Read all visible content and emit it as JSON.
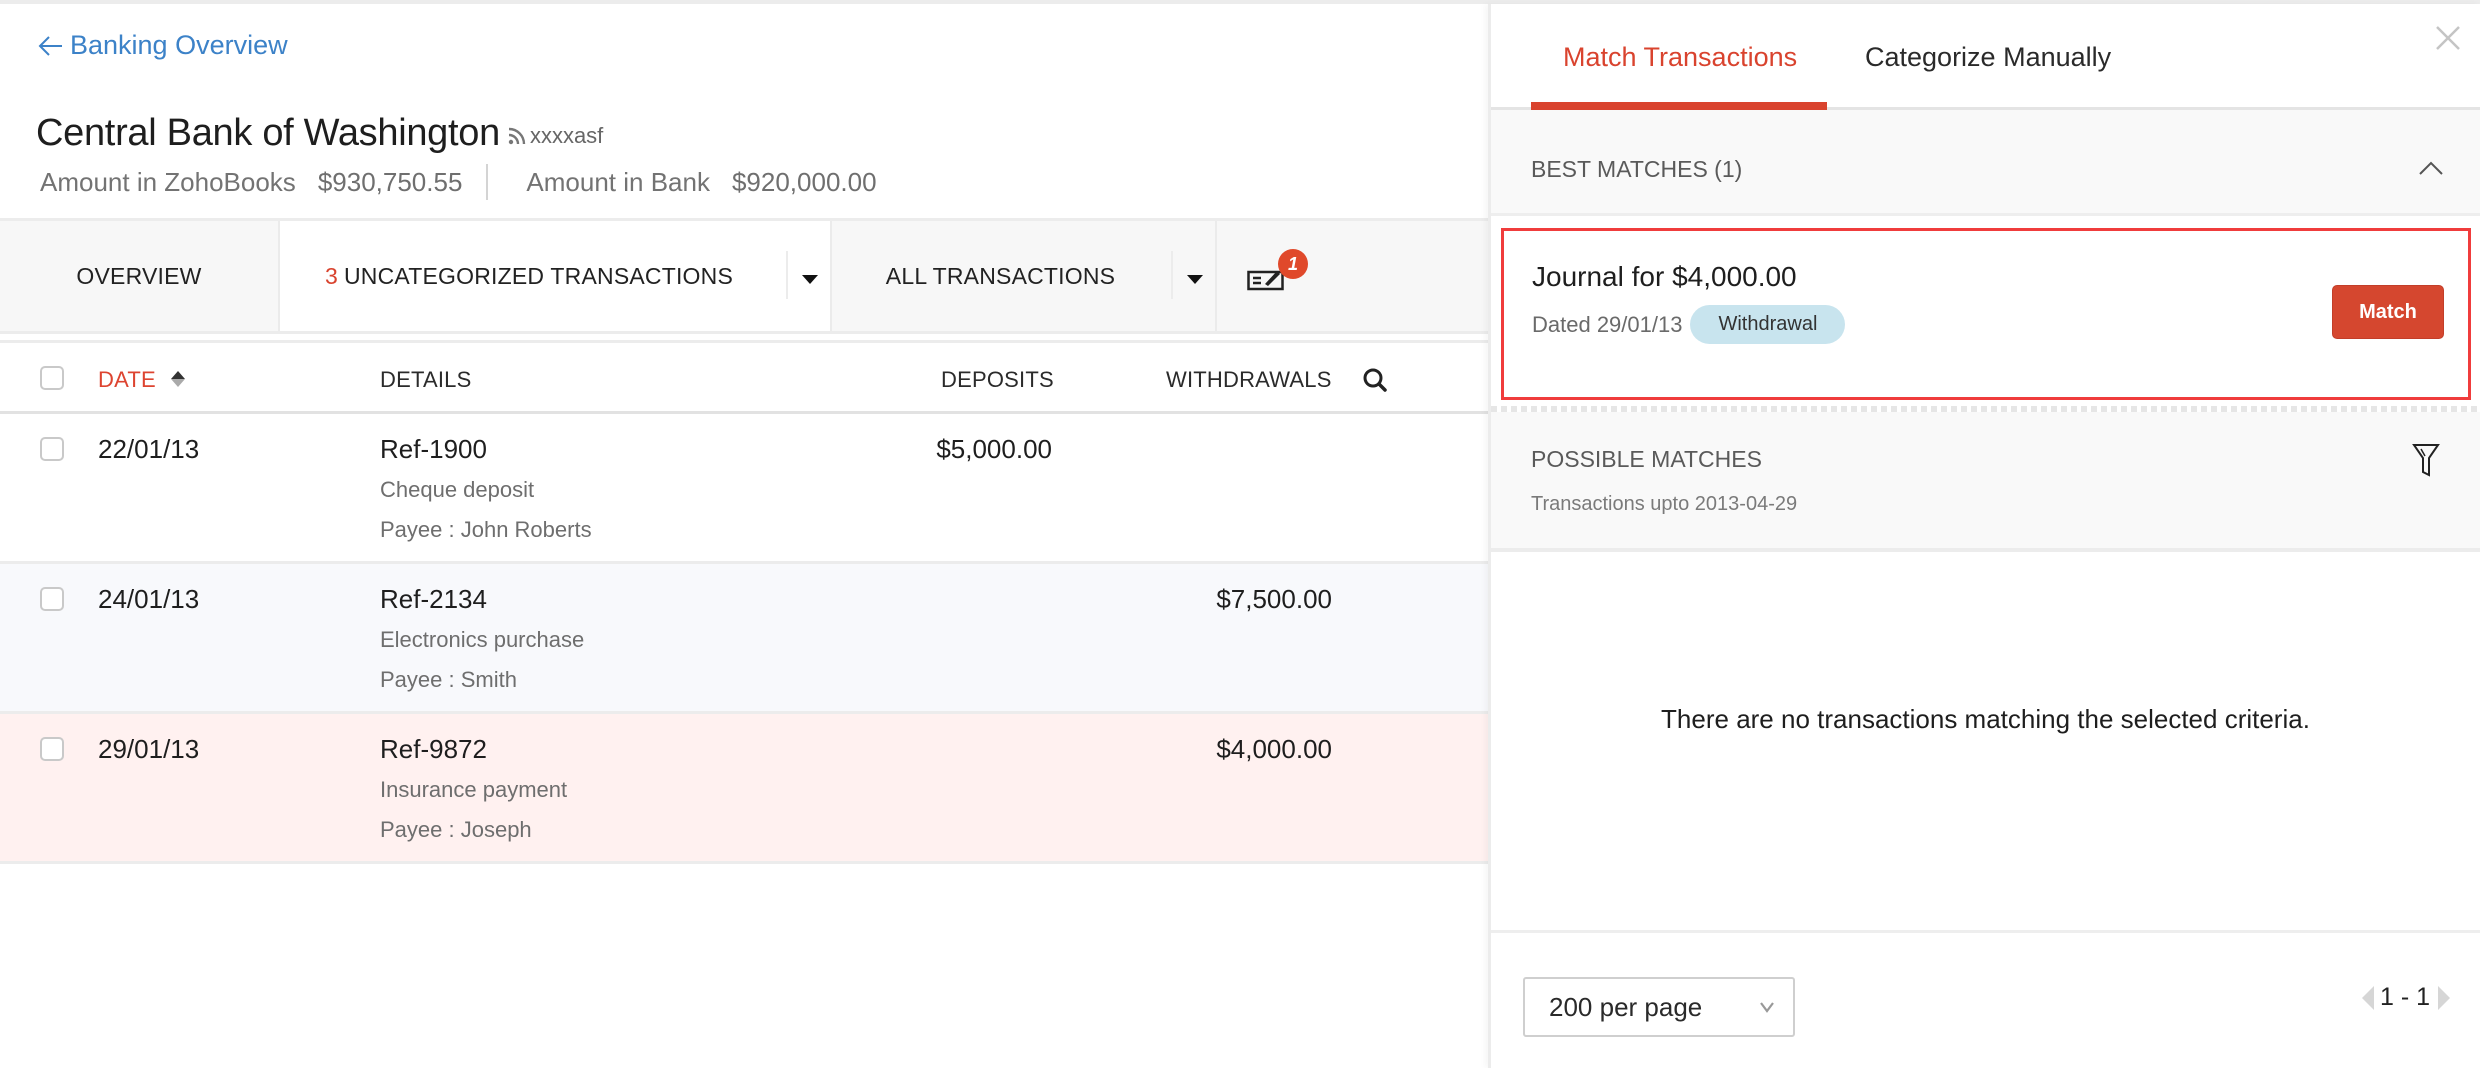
{
  "header": {
    "back_label": "Banking Overview",
    "bank_name": "Central Bank of Washington",
    "feed_account": "xxxxasf",
    "amount_books_label": "Amount in ZohoBooks",
    "amount_books_value": "$930,750.55",
    "amount_bank_label": "Amount in Bank",
    "amount_bank_value": "$920,000.00"
  },
  "tabbar": {
    "overview": "OVERVIEW",
    "uncategorized_count": "3",
    "uncategorized_label": "UNCATEGORIZED TRANSACTIONS",
    "all_transactions": "ALL TRANSACTIONS",
    "cheque_badge": "1"
  },
  "table": {
    "columns": {
      "date": "DATE",
      "details": "DETAILS",
      "deposits": "DEPOSITS",
      "withdrawals": "WITHDRAWALS"
    },
    "rows": [
      {
        "date": "22/01/13",
        "ref": "Ref-1900",
        "description": "Cheque deposit",
        "payee": "Payee : John Roberts",
        "deposit": "$5,000.00",
        "withdrawal": ""
      },
      {
        "date": "24/01/13",
        "ref": "Ref-2134",
        "description": "Electronics purchase",
        "payee": "Payee : Smith",
        "deposit": "",
        "withdrawal": "$7,500.00"
      },
      {
        "date": "29/01/13",
        "ref": "Ref-9872",
        "description": "Insurance payment",
        "payee": "Payee : Joseph",
        "deposit": "",
        "withdrawal": "$4,000.00"
      }
    ]
  },
  "panel": {
    "tabs": [
      {
        "label": "Match Transactions",
        "active": true
      },
      {
        "label": "Categorize Manually",
        "active": false
      }
    ],
    "best_matches_title": "BEST MATCHES (1)",
    "best_match": {
      "title": "Journal for $4,000.00",
      "dated": "Dated 29/01/13",
      "type_badge": "Withdrawal",
      "match_button": "Match"
    },
    "possible_matches_title": "POSSIBLE MATCHES",
    "possible_matches_sub": "Transactions upto 2013-04-29",
    "empty_message": "There are no transactions matching the selected criteria.",
    "per_page": "200 per page",
    "pagination": "1 - 1"
  },
  "colors": {
    "accent_red": "#d9432e",
    "link_blue": "#3c82c8",
    "highlight_border": "#f03c3c",
    "withdrawal_badge": "#c8e4ee",
    "selected_row": "#fff1f0"
  }
}
